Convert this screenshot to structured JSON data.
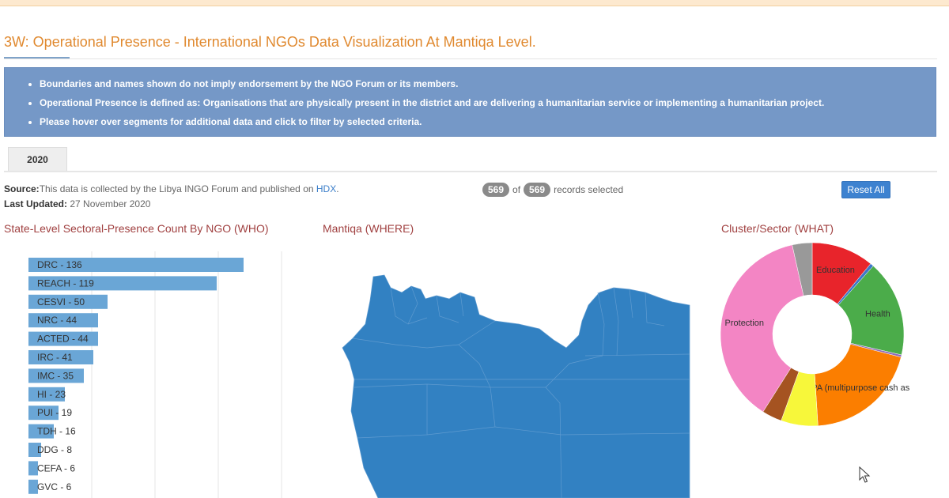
{
  "header": {
    "title": "3W: Operational Presence - International NGOs Data Visualization At Mantiqa Level."
  },
  "notice": {
    "items": [
      "Boundaries and names shown do not imply endorsement by the NGO Forum or its members.",
      "Operational Presence is defined as: Organisations that are physically present in the district and are delivering a humanitarian service or implementing a humanitarian project.",
      "Please hover over segments for additional data and click to filter by selected criteria."
    ]
  },
  "tabs": [
    {
      "label": "2020"
    }
  ],
  "info": {
    "source_label": "Source:",
    "source_text": "This data is collected by the Libya INGO Forum and published on ",
    "source_link": "HDX",
    "source_end": ".",
    "updated_label": "Last Updated:",
    "updated_value": " 27 November 2020"
  },
  "records": {
    "selected": "569",
    "of": "of",
    "total": "569",
    "suffix": "records selected"
  },
  "reset_label": "Reset All",
  "colors": {
    "bar": "#6aa6d6",
    "map": "#3281c2",
    "accent": "#e0892f",
    "notice": "#7598c7"
  },
  "chart_data": [
    {
      "type": "bar",
      "title": "State-Level Sectoral-Presence Count By NGO (WHO)",
      "orientation": "horizontal",
      "categories": [
        "DRC",
        "REACH",
        "CESVI",
        "NRC",
        "ACTED",
        "IRC",
        "IMC",
        "HI",
        "PUI",
        "TDH",
        "DDG",
        "CEFA",
        "GVC"
      ],
      "values": [
        136,
        119,
        50,
        44,
        44,
        41,
        35,
        23,
        19,
        16,
        8,
        6,
        6
      ],
      "labels": [
        "DRC - 136",
        "REACH - 119",
        "CESVI - 50",
        "NRC - 44",
        "ACTED - 44",
        "IRC - 41",
        "IMC - 35",
        "HI - 23",
        "PUI - 19",
        "TDH - 16",
        "DDG - 8",
        "CEFA - 6",
        "GVC - 6"
      ],
      "xlim": [
        0,
        170
      ],
      "grid": true
    },
    {
      "type": "map",
      "title": "Mantiqa (WHERE)"
    },
    {
      "type": "pie",
      "title": "Cluster/Sector (WHAT)",
      "donut": true,
      "slices": [
        {
          "name": "Education",
          "value": 11,
          "color": "#e8242b",
          "label": "Education"
        },
        {
          "name": "",
          "value": 0.6,
          "color": "#3c78c8",
          "label": ""
        },
        {
          "name": "Health",
          "value": 17,
          "color": "#4bac4a",
          "label": "Health"
        },
        {
          "name": "",
          "value": 0.4,
          "color": "#8e6ab9",
          "label": ""
        },
        {
          "name": "MCPA (multipurpose cash assistance)",
          "value": 20,
          "color": "#fb7e00",
          "label": "MCPA (multipurpose cash ass"
        },
        {
          "name": "",
          "value": 6.5,
          "color": "#f7f73a",
          "label": ""
        },
        {
          "name": "",
          "value": 3.5,
          "color": "#a55321",
          "label": ""
        },
        {
          "name": "Protection",
          "value": 37.5,
          "color": "#f385c4",
          "label": "Protection"
        },
        {
          "name": "",
          "value": 3.5,
          "color": "#999999",
          "label": ""
        }
      ]
    }
  ]
}
